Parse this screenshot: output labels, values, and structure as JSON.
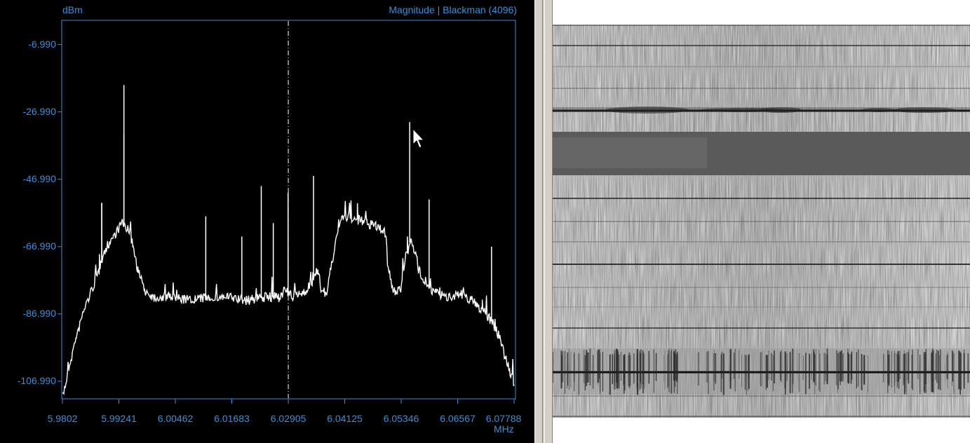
{
  "spectrum": {
    "y_unit": "dBm",
    "mode_label": "Magnitude | Blackman (4096)",
    "x_unit": "MHz",
    "background_color": "#000000",
    "axis_color": "#3a8fd8",
    "trace_color": "#ffffff"
  },
  "chart_data": {
    "type": "line",
    "xlabel": "MHz",
    "ylabel": "dBm",
    "x_ticks": [
      "5.9802",
      "5.99241",
      "6.00462",
      "6.01683",
      "6.02905",
      "6.04125",
      "6.05346",
      "6.06567",
      "6.07788"
    ],
    "y_ticks": [
      "-6.990",
      "-26.990",
      "-46.990",
      "-66.990",
      "-86.990",
      "-106.990"
    ],
    "xlim": [
      5.9802,
      6.07788
    ],
    "ylim": [
      -112,
      0
    ],
    "cursor_x": 6.02905,
    "series": [
      {
        "x": [
          5.9802,
          5.9816,
          5.9832,
          5.9848,
          5.9865,
          5.9882,
          5.9898,
          5.9912,
          5.9922,
          5.993,
          5.9939,
          5.9948,
          5.9955,
          5.9965,
          5.998,
          6.0,
          6.004,
          6.008,
          6.012,
          6.016,
          6.02,
          6.024,
          6.027,
          6.0282,
          6.03,
          6.033,
          6.0355,
          6.0362,
          6.0372,
          6.04,
          6.042,
          6.044,
          6.046,
          6.048,
          6.0502,
          6.0505,
          6.052,
          6.0535,
          6.054,
          6.0548,
          6.0556,
          6.0563,
          6.0572,
          6.06,
          6.063,
          6.066,
          6.069,
          6.071,
          6.073,
          6.075,
          6.076,
          6.077,
          6.0779
        ],
        "y": [
          -112,
          -103,
          -94,
          -86,
          -80,
          -74,
          -67,
          -64,
          -62,
          -60,
          -61,
          -63,
          -67,
          -74,
          -80,
          -82,
          -82,
          -83,
          -82,
          -82,
          -83,
          -82,
          -82,
          -80,
          -82,
          -80,
          -75,
          -80,
          -82,
          -60,
          -58,
          -59,
          -60,
          -61,
          -63,
          -72,
          -82,
          -79,
          -73,
          -69,
          -64,
          -68,
          -74,
          -80,
          -82,
          -81,
          -83,
          -86,
          -89,
          -95,
          -100,
          -104,
          -108
        ]
      }
    ],
    "spikes": [
      {
        "x": 5.9935,
        "y": -19
      },
      {
        "x": 5.9935,
        "y": -34
      },
      {
        "x": 5.9887,
        "y": -54
      },
      {
        "x": 5.9887,
        "y": -54
      },
      {
        "x": 6.0112,
        "y": -58
      },
      {
        "x": 6.019,
        "y": -64
      },
      {
        "x": 6.0232,
        "y": -49
      },
      {
        "x": 6.0258,
        "y": -60
      },
      {
        "x": 6.029,
        "y": -51
      },
      {
        "x": 6.0345,
        "y": -46
      },
      {
        "x": 6.0553,
        "y": -30
      },
      {
        "x": 6.0595,
        "y": -53
      },
      {
        "x": 6.073,
        "y": -67
      }
    ]
  }
}
